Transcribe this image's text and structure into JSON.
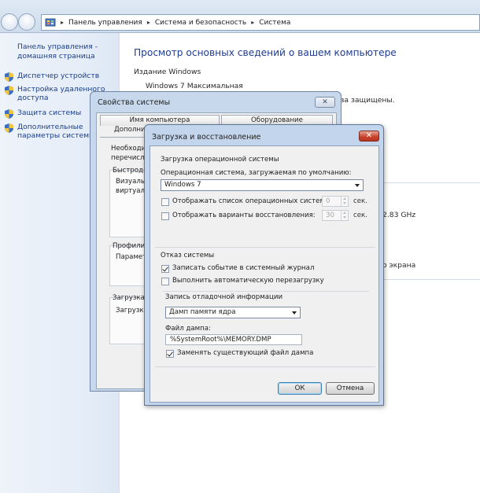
{
  "explorer": {
    "breadcrumb": [
      "Панель управления",
      "Система и безопасность",
      "Система"
    ],
    "left_pane": {
      "home": "Панель управления - домашняя страница",
      "items": [
        "Диспетчер устройств",
        "Настройка удаленного доступа",
        "Защита системы",
        "Дополнительные параметры системы"
      ]
    },
    "main": {
      "title": "Просмотр основных сведений о вашем компьютере",
      "edition_label": "Издание Windows",
      "edition_value": "Windows 7 Максимальная",
      "protected_fragment": "ва защищены.",
      "cpu_fragment": "2.83 GHz",
      "screen_fragment": "о экрана"
    }
  },
  "system_properties": {
    "title": "Свойства системы",
    "close_glyph": "✕",
    "tabs": [
      "Имя компьютера",
      "Оборудование"
    ],
    "active_tab_fragment": "Дополните",
    "admin_note": [
      "Необходим",
      "перечислен"
    ],
    "performance": {
      "label": "Быстроде",
      "text": [
        "Визуальн",
        "виртуальн"
      ]
    },
    "profiles": {
      "label": "Профили п",
      "text": "Параметр"
    },
    "startup": {
      "label": "Загрузка и",
      "text": "Загрузка и"
    }
  },
  "dialog": {
    "title": "Загрузка и восстановление",
    "close_glyph": "✕",
    "boot_section": "Загрузка операционной системы",
    "default_os_label": "Операционная система, загружаемая по умолчанию:",
    "default_os_value": "Windows 7",
    "show_list_label": "Отображать список операционных систем:",
    "show_list_value": "0",
    "show_recovery_label": "Отображать варианты восстановления:",
    "show_recovery_value": "30",
    "seconds": "сек.",
    "failure_section": "Отказ системы",
    "write_event_label": "Записать событие в системный журнал",
    "auto_restart_label": "Выполнить автоматическую перезагрузку",
    "debug_section": "Запись отладочной информации",
    "dump_type_value": "Дамп памяти ядра",
    "dump_file_label": "Файл дампа:",
    "dump_file_value": "%SystemRoot%\\MEMORY.DMP",
    "overwrite_label": "Заменять существующий файл дампа",
    "ok": "ОК",
    "cancel": "Отмена"
  },
  "colors": {
    "link": "#1a3e8a",
    "title_text": "#1e3c91",
    "dialog_frame": "#c3d5ec",
    "close_red": "#c5412a"
  }
}
